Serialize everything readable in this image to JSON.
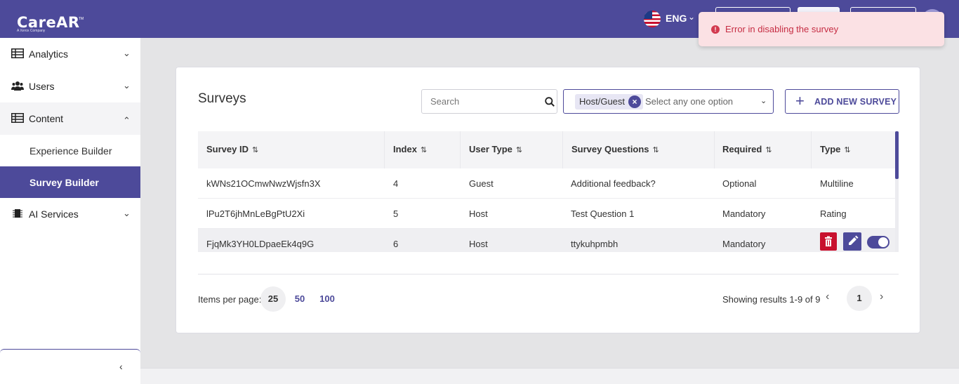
{
  "header": {
    "logo_text": "CareAR",
    "logo_tm": "TM",
    "logo_sub": "A Xerox Company",
    "language": "ENG"
  },
  "toast": {
    "icon": "info-icon",
    "message": "Error in disabling the survey"
  },
  "sidebar": {
    "items": [
      {
        "label": "Analytics",
        "icon": "table-icon"
      },
      {
        "label": "Users",
        "icon": "users-icon"
      },
      {
        "label": "Content",
        "icon": "table-icon",
        "expanded": true,
        "children": [
          {
            "label": "Experience Builder"
          },
          {
            "label": "Survey Builder",
            "active": true
          }
        ]
      },
      {
        "label": "AI Services",
        "icon": "chip-icon"
      }
    ],
    "collapse_icon": "chevron-left-icon"
  },
  "main": {
    "title": "Surveys",
    "search": {
      "placeholder": "Search",
      "value": ""
    },
    "filter": {
      "selected_chip": "Host/Guest",
      "placeholder": "Select any one option"
    },
    "add_button": "ADD NEW SURVEY",
    "table": {
      "columns": [
        "Survey ID",
        "Index",
        "User Type",
        "Survey Questions",
        "Required",
        "Type"
      ],
      "rows": [
        {
          "id": "kWNs21OCmwNwzWjsfn3X",
          "index": "4",
          "user_type": "Guest",
          "question": "Additional feedback?",
          "required": "Optional",
          "type": "Multiline"
        },
        {
          "id": "lPu2T6jhMnLeBgPtU2Xi",
          "index": "5",
          "user_type": "Host",
          "question": "Test Question 1",
          "required": "Mandatory",
          "type": "Rating"
        },
        {
          "id": "FjqMk3YH0LDpaeEk4q9G",
          "index": "6",
          "user_type": "Host",
          "question": "ttykuhpmbh",
          "required": "Mandatory",
          "type": ""
        }
      ]
    },
    "pagination": {
      "items_per_page_label": "Items per page:",
      "options": [
        "25",
        "50",
        "100"
      ],
      "selected": "25",
      "showing": "Showing results 1-9 of 9",
      "current_page": "1"
    }
  },
  "colors": {
    "brand": "#4d4a9a",
    "danger": "#c8102e",
    "toast_bg": "#fbe1e4",
    "toast_text": "#c62d43"
  }
}
